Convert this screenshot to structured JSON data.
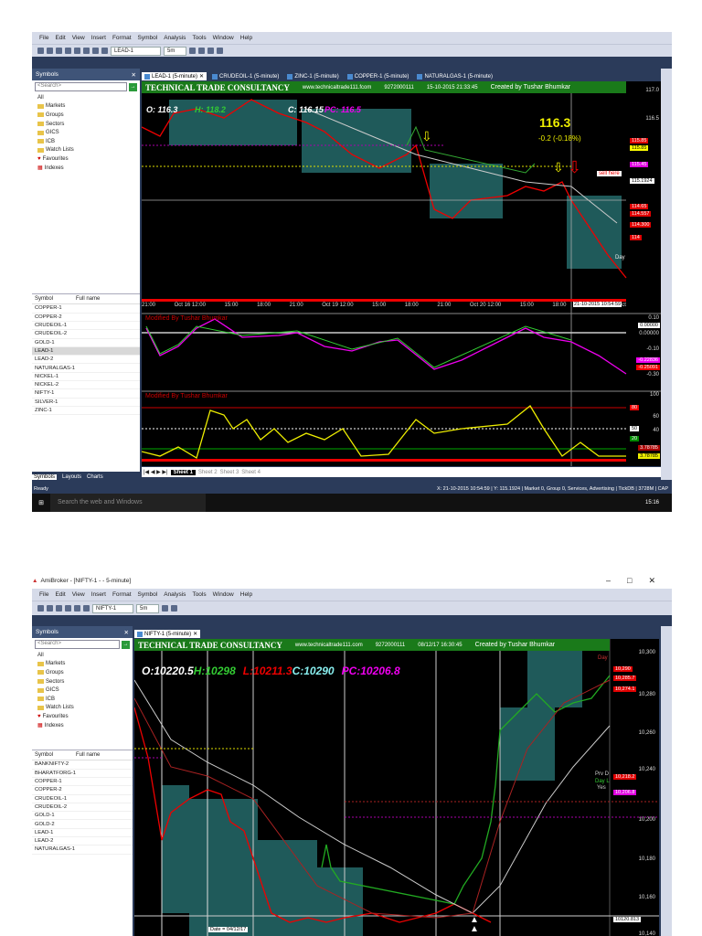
{
  "top": {
    "menu": [
      "File",
      "Edit",
      "View",
      "Insert",
      "Format",
      "Symbol",
      "Analysis",
      "Tools",
      "Window",
      "Help"
    ],
    "symbol_select": "LEAD-1",
    "interval_select": "5m",
    "panel_title": "Symbols",
    "search_placeholder": "<Search>",
    "tree": [
      "All",
      "Markets",
      "Groups",
      "Sectors",
      "GICS",
      "ICB",
      "Watch Lists",
      "Favourites",
      "Indexes"
    ],
    "list_headers": [
      "Symbol",
      "Full name"
    ],
    "symbols": [
      "COPPER-1",
      "COPPER-2",
      "CRUDEOIL-1",
      "CRUDEOIL-2",
      "GOLD-1",
      "LEAD-1",
      "LEAD-2",
      "NATURALGAS-1",
      "NICKEL-1",
      "NICKEL-2",
      "NIFTY-1",
      "SILVER-1",
      "ZINC-1"
    ],
    "selected_symbol": "LEAD-1",
    "panel_tabs": [
      "Symbols",
      "Layouts",
      "Charts"
    ],
    "chart_tabs": [
      "LEAD-1 (5-minute)",
      "CRUDEOIL-1 (5-minute)",
      "ZINC-1 (5-minute)",
      "COPPER-1 (5-minute)",
      "NATURALGAS-1 (5-minute)"
    ],
    "banner": {
      "title": "TECHNICAL TRADE CONSULTANCY",
      "url": "www.technicaltrade111.fcom",
      "phone": "9272000111",
      "datetime": "15-10-2015 21:33:45",
      "credit": "Created by Tushar Bhumkar"
    },
    "ohlc": {
      "o": "O: 116.3",
      "h": "H: 118.2",
      "c": "C: 116.15",
      "pc": "PC: 116.5"
    },
    "last_price": "116.3",
    "change": "-0.2 (-0.18%)",
    "sell_note": "sell here",
    "price_axis": [
      "117.0",
      "116.5"
    ],
    "price_labels": [
      {
        "t": "115.85",
        "c": "#e00000"
      },
      {
        "t": "115.85",
        "c": "#ffff00"
      },
      {
        "t": "115.45",
        "c": "#e000e0"
      },
      {
        "t": "115.1924",
        "c": "#ffffff"
      },
      {
        "t": "114.65",
        "c": "#e00000"
      },
      {
        "t": "114.557",
        "c": "#e00000"
      },
      {
        "t": "114.300",
        "c": "#e00000"
      },
      {
        "t": "114",
        "c": "#e00000"
      }
    ],
    "day_label": "Day",
    "time_axis": [
      "21:00",
      "Oct 16 12:00",
      "15:00",
      "18:00",
      "21:00",
      "Oct 19 12:00",
      "15:00",
      "18:00",
      "21:00",
      "Oct 20 12:00",
      "15:00",
      "18:00",
      "21:00",
      "Oct"
    ],
    "crosshair_date": "21-10-2015 10:54:59",
    "ind1": {
      "title": "Modified By Tushar Bhumkar",
      "axis": [
        "0.10",
        "0.00000",
        "0.00000",
        "-0.10",
        "-0.30"
      ],
      "val1": "-0.22836",
      "val2": "-0.25091"
    },
    "ind2": {
      "title": "Modified By Tushar Bhumkar",
      "axis": [
        "100",
        "80",
        "60",
        "50",
        "40",
        "20"
      ],
      "val1": "3.78785",
      "val2": "3.78785"
    },
    "sheets": [
      "Sheet 1",
      "Sheet 2",
      "Sheet 3",
      "Sheet 4"
    ],
    "status_left": "Ready",
    "status_right": "X: 21-10-2015 10:54:59 | Y: 115.1924 | Market 0, Group 0, Services, Advertising | TickDB | 3728M | CAP",
    "search_web": "Search the web and Windows",
    "clock": "15:16"
  },
  "bottom": {
    "window_title": "AmiBroker - [NIFTY-1 - - 5-minute]",
    "menu": [
      "File",
      "Edit",
      "View",
      "Insert",
      "Format",
      "Symbol",
      "Analysis",
      "Tools",
      "Window",
      "Help"
    ],
    "symbol_select": "NIFTY-1",
    "interval_select": "5m",
    "panel_title": "Symbols",
    "search_placeholder": "<Search>",
    "tree": [
      "All",
      "Markets",
      "Groups",
      "Sectors",
      "GICS",
      "ICB",
      "Watch Lists",
      "Favourites",
      "Indexes"
    ],
    "list_headers": [
      "Symbol",
      "Full name"
    ],
    "symbols": [
      "BANKNIFTY-2",
      "BHARATFORG-1",
      "COPPER-1",
      "COPPER-2",
      "CRUDEOIL-1",
      "CRUDEOIL-2",
      "GOLD-1",
      "GOLD-2",
      "LEAD-1",
      "LEAD-2",
      "NATURALGAS-1"
    ],
    "chart_tab": "NIFTY-1 (5-minute)",
    "banner": {
      "title": "TECHNICAL TRADE CONSULTANCY",
      "url": "www.technicaltrade111.com",
      "phone": "9272000111",
      "datetime": "08/12/17 16:30:45",
      "credit": "Created by Tushar Bhumkar"
    },
    "ohlc": {
      "o": "O:10220.5",
      "h": "H:10298",
      "l": "L:10211.3",
      "c": "C:10290",
      "pc": "PC:10206.8"
    },
    "price_axis": [
      "10,300",
      "10,280",
      "10,260",
      "10,240",
      "10,200",
      "10,180",
      "10,160",
      "10,140"
    ],
    "price_labels": [
      {
        "t": "10,290",
        "c": "#e00000"
      },
      {
        "t": "10,285.7",
        "c": "#e00000"
      },
      {
        "t": "10,274.1",
        "c": "#e00000"
      },
      {
        "t": "10,218.2",
        "c": "#e00000"
      },
      {
        "t": "10,206.8",
        "c": "#e000e0"
      },
      {
        "t": "10120.813",
        "c": "#ffffff"
      }
    ],
    "level_labels": [
      "Day",
      "Prv D",
      "Day L",
      "Yes"
    ],
    "date_tip": "Date = 04/12/17"
  }
}
